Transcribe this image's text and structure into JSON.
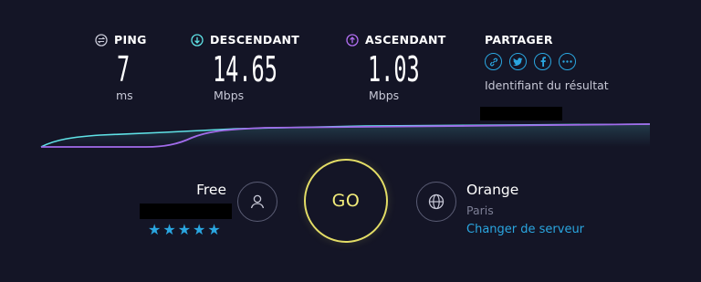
{
  "metrics": {
    "ping": {
      "label": "PING",
      "value": "7",
      "unit": "ms",
      "icon": "ping-icon",
      "color": "#c7c8d6"
    },
    "download": {
      "label": "DESCENDANT",
      "value": "14.65",
      "unit": "Mbps",
      "icon": "download-arrow-icon",
      "color": "#5fe2e6"
    },
    "upload": {
      "label": "ASCENDANT",
      "value": "1.03",
      "unit": "Mbps",
      "icon": "upload-arrow-icon",
      "color": "#b06ef0"
    }
  },
  "share": {
    "label": "PARTAGER",
    "icons": [
      {
        "name": "link-icon",
        "glyph": "🔗"
      },
      {
        "name": "twitter-icon",
        "glyph": "t"
      },
      {
        "name": "facebook-icon",
        "glyph": "f"
      },
      {
        "name": "more-icon",
        "glyph": "•••"
      }
    ],
    "result_id_label": "Identifiant du résultat"
  },
  "isp": {
    "name": "Free",
    "rating": 5,
    "stars": "★★★★★",
    "icon": "user-icon"
  },
  "go_button": {
    "label": "GO",
    "color": "#e3dd66"
  },
  "server": {
    "name": "Orange",
    "location": "Paris",
    "change_label": "Changer de serveur",
    "icon": "globe-icon"
  },
  "colors": {
    "background": "#141526",
    "accent": "#2aa6e0",
    "download_line": "#5fe2e6",
    "upload_line": "#a16bea"
  }
}
